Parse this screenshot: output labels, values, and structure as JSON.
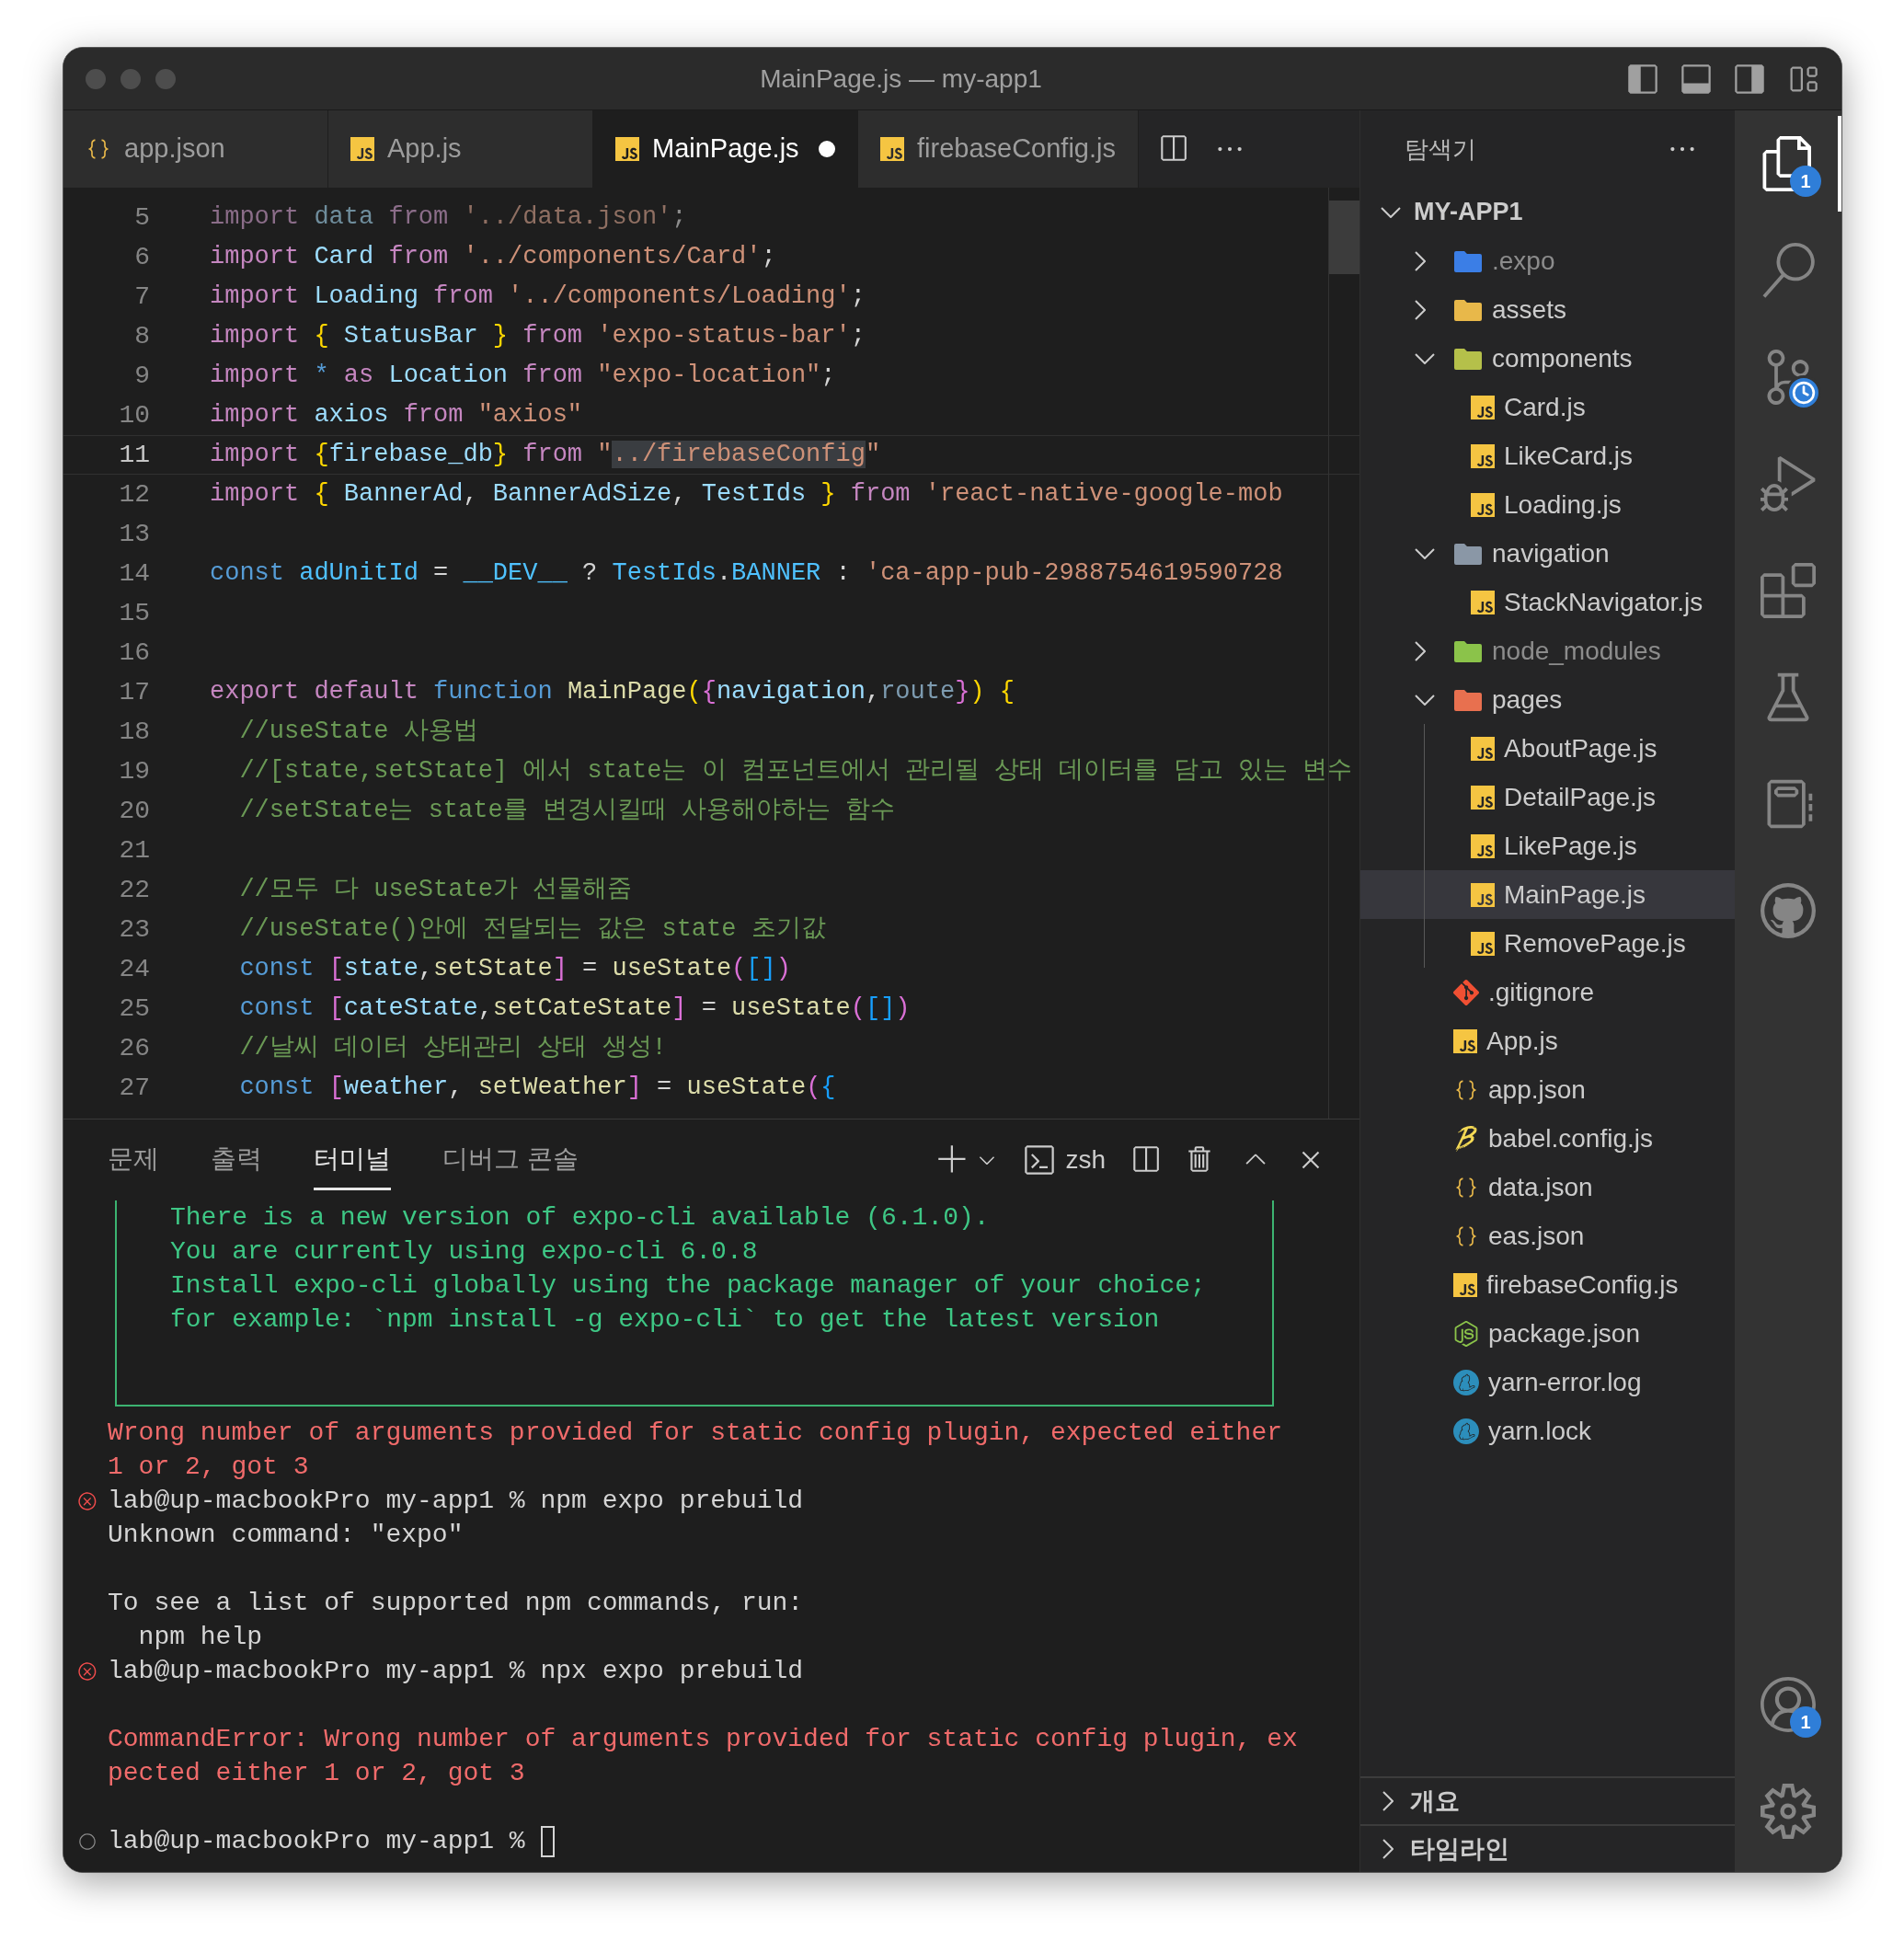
{
  "window": {
    "title": "MainPage.js — my-app1"
  },
  "tabs": [
    {
      "label": "app.json",
      "kind": "json",
      "selected": false,
      "modified": false
    },
    {
      "label": "App.js",
      "kind": "js",
      "selected": false,
      "modified": false
    },
    {
      "label": "MainPage.js",
      "kind": "js",
      "selected": true,
      "modified": true
    },
    {
      "label": "firebaseConfig.js",
      "kind": "js",
      "selected": false,
      "modified": false
    }
  ],
  "editor": {
    "lines": [
      {
        "n": "5",
        "current": false,
        "tokens": [
          {
            "kind": "kw_faded",
            "text": "import "
          },
          {
            "kind": "var_faded",
            "text": "data "
          },
          {
            "kind": "kw_faded",
            "text": "from "
          },
          {
            "kind": "str_faded",
            "text": "'../data.json'"
          },
          {
            "kind": "plain_faded",
            "text": ";"
          }
        ]
      },
      {
        "n": "6",
        "current": false,
        "tokens": [
          {
            "kind": "kw",
            "text": "import "
          },
          {
            "kind": "var",
            "text": "Card "
          },
          {
            "kind": "kw",
            "text": "from "
          },
          {
            "kind": "str",
            "text": "'../components/Card'"
          },
          {
            "kind": "plain",
            "text": ";"
          }
        ]
      },
      {
        "n": "7",
        "current": false,
        "tokens": [
          {
            "kind": "kw",
            "text": "import "
          },
          {
            "kind": "var",
            "text": "Loading "
          },
          {
            "kind": "kw",
            "text": "from "
          },
          {
            "kind": "str",
            "text": "'../components/Loading'"
          },
          {
            "kind": "plain",
            "text": ";"
          }
        ]
      },
      {
        "n": "8",
        "current": false,
        "tokens": [
          {
            "kind": "kw",
            "text": "import "
          },
          {
            "kind": "b1",
            "text": "{"
          },
          {
            "kind": "var",
            "text": " StatusBar "
          },
          {
            "kind": "b1",
            "text": "}"
          },
          {
            "kind": "kw",
            "text": " from "
          },
          {
            "kind": "str",
            "text": "'expo-status-bar'"
          },
          {
            "kind": "plain",
            "text": ";"
          }
        ]
      },
      {
        "n": "9",
        "current": false,
        "tokens": [
          {
            "kind": "kw",
            "text": "import "
          },
          {
            "kind": "storage",
            "text": "* "
          },
          {
            "kind": "kw",
            "text": "as "
          },
          {
            "kind": "var",
            "text": "Location "
          },
          {
            "kind": "kw",
            "text": "from "
          },
          {
            "kind": "str",
            "text": "\"expo-location\""
          },
          {
            "kind": "plain",
            "text": ";"
          }
        ]
      },
      {
        "n": "10",
        "current": false,
        "tokens": [
          {
            "kind": "kw",
            "text": "import "
          },
          {
            "kind": "var",
            "text": "axios "
          },
          {
            "kind": "kw",
            "text": "from "
          },
          {
            "kind": "str",
            "text": "\"axios\""
          }
        ]
      },
      {
        "n": "11",
        "current": true,
        "tokens": [
          {
            "kind": "kw",
            "text": "import "
          },
          {
            "kind": "b1",
            "text": "{"
          },
          {
            "kind": "var",
            "text": "firebase_db"
          },
          {
            "kind": "b1",
            "text": "}"
          },
          {
            "kind": "kw",
            "text": " from "
          },
          {
            "kind": "str",
            "text": "\""
          },
          {
            "kind": "str_hl",
            "text": "../firebaseConfig"
          },
          {
            "kind": "str",
            "text": "\""
          }
        ]
      },
      {
        "n": "12",
        "current": false,
        "tokens": [
          {
            "kind": "kw",
            "text": "import "
          },
          {
            "kind": "b1",
            "text": "{"
          },
          {
            "kind": "var",
            "text": " BannerAd"
          },
          {
            "kind": "plain",
            "text": ", "
          },
          {
            "kind": "var",
            "text": "BannerAdSize"
          },
          {
            "kind": "plain",
            "text": ", "
          },
          {
            "kind": "var",
            "text": "TestIds "
          },
          {
            "kind": "b1",
            "text": "}"
          },
          {
            "kind": "kw",
            "text": " from "
          },
          {
            "kind": "str",
            "text": "'react-native-google-mob"
          }
        ]
      },
      {
        "n": "13",
        "current": false
      },
      {
        "n": "14",
        "current": false,
        "tokens": [
          {
            "kind": "storage",
            "text": "const "
          },
          {
            "kind": "const",
            "text": "adUnitId"
          },
          {
            "kind": "plain",
            "text": " = "
          },
          {
            "kind": "const",
            "text": "__DEV__"
          },
          {
            "kind": "plain",
            "text": " ? "
          },
          {
            "kind": "const",
            "text": "TestIds"
          },
          {
            "kind": "plain",
            "text": "."
          },
          {
            "kind": "const",
            "text": "BANNER"
          },
          {
            "kind": "plain",
            "text": " : "
          },
          {
            "kind": "str",
            "text": "'ca-app-pub-2988754619590728"
          }
        ]
      },
      {
        "n": "15",
        "current": false
      },
      {
        "n": "16",
        "current": false
      },
      {
        "n": "17",
        "current": false,
        "tokens": [
          {
            "kind": "kw",
            "text": "export default "
          },
          {
            "kind": "storage",
            "text": "function "
          },
          {
            "kind": "func",
            "text": "MainPage"
          },
          {
            "kind": "b1",
            "text": "("
          },
          {
            "kind": "b2",
            "text": "{"
          },
          {
            "kind": "var",
            "text": "navigation"
          },
          {
            "kind": "plain",
            "text": ","
          },
          {
            "kind": "unused",
            "text": "route"
          },
          {
            "kind": "b2",
            "text": "}"
          },
          {
            "kind": "b1",
            "text": ")"
          },
          {
            "kind": "b1",
            "text": " {"
          }
        ]
      },
      {
        "n": "18",
        "current": false,
        "tokens": [
          {
            "kind": "comment",
            "text": "  //useState 사용법"
          }
        ]
      },
      {
        "n": "19",
        "current": false,
        "tokens": [
          {
            "kind": "comment",
            "text": "  //[state,setState] 에서 state는 이 컴포넌트에서 관리될 상태 데이터를 담고 있는 변수"
          }
        ]
      },
      {
        "n": "20",
        "current": false,
        "tokens": [
          {
            "kind": "comment",
            "text": "  //setState는 state를 변경시킬때 사용해야하는 함수"
          }
        ]
      },
      {
        "n": "21",
        "current": false
      },
      {
        "n": "22",
        "current": false,
        "tokens": [
          {
            "kind": "comment",
            "text": "  //모두 다 useState가 선물해줌"
          }
        ]
      },
      {
        "n": "23",
        "current": false,
        "tokens": [
          {
            "kind": "comment",
            "text": "  //useState()안에 전달되는 값은 state 초기값"
          }
        ]
      },
      {
        "n": "24",
        "current": false,
        "tokens": [
          {
            "kind": "storage",
            "text": "  const "
          },
          {
            "kind": "b2",
            "text": "["
          },
          {
            "kind": "var",
            "text": "state"
          },
          {
            "kind": "plain",
            "text": ","
          },
          {
            "kind": "func",
            "text": "setState"
          },
          {
            "kind": "b2",
            "text": "]"
          },
          {
            "kind": "plain",
            "text": " = "
          },
          {
            "kind": "func",
            "text": "useState"
          },
          {
            "kind": "b2",
            "text": "("
          },
          {
            "kind": "b3",
            "text": "[]"
          },
          {
            "kind": "b2",
            "text": ")"
          }
        ]
      },
      {
        "n": "25",
        "current": false,
        "tokens": [
          {
            "kind": "storage",
            "text": "  const "
          },
          {
            "kind": "b2",
            "text": "["
          },
          {
            "kind": "var",
            "text": "cateState"
          },
          {
            "kind": "plain",
            "text": ","
          },
          {
            "kind": "func",
            "text": "setCateState"
          },
          {
            "kind": "b2",
            "text": "]"
          },
          {
            "kind": "plain",
            "text": " = "
          },
          {
            "kind": "func",
            "text": "useState"
          },
          {
            "kind": "b2",
            "text": "("
          },
          {
            "kind": "b3",
            "text": "[]"
          },
          {
            "kind": "b2",
            "text": ")"
          }
        ]
      },
      {
        "n": "26",
        "current": false,
        "tokens": [
          {
            "kind": "comment",
            "text": "  //날씨 데이터 상태관리 상태 생성!"
          }
        ]
      },
      {
        "n": "27",
        "current": false,
        "tokens": [
          {
            "kind": "storage",
            "text": "  const "
          },
          {
            "kind": "b2",
            "text": "["
          },
          {
            "kind": "var",
            "text": "weather"
          },
          {
            "kind": "plain",
            "text": ", "
          },
          {
            "kind": "func",
            "text": "setWeather"
          },
          {
            "kind": "b2",
            "text": "]"
          },
          {
            "kind": "plain",
            "text": " = "
          },
          {
            "kind": "func",
            "text": "useState"
          },
          {
            "kind": "b2",
            "text": "("
          },
          {
            "kind": "b3",
            "text": "{"
          }
        ]
      }
    ]
  },
  "panel": {
    "tabs": [
      {
        "label": "문제",
        "selected": false
      },
      {
        "label": "출력",
        "selected": false
      },
      {
        "label": "터미널",
        "selected": true
      },
      {
        "label": "디버그 콘솔",
        "selected": false
      }
    ],
    "shell": "zsh",
    "terminal": {
      "box_lines": [
        "There is a new version of expo-cli available (6.1.0).",
        "You are currently using expo-cli 6.0.8",
        "Install expo-cli globally using the package manager of your choice;",
        "for example: `npm install -g expo-cli` to get the latest version"
      ],
      "lines": [
        {
          "kind": "error",
          "text": "Wrong number of arguments provided for static config plugin, expected either"
        },
        {
          "kind": "error",
          "text": "1 or 2, got 3"
        },
        {
          "kind": "prompt_failed",
          "text": "lab@up-macbookPro my-app1 % npm expo prebuild"
        },
        {
          "kind": "output",
          "text": "Unknown command: \"expo\""
        },
        {
          "kind": "blank"
        },
        {
          "kind": "output",
          "text": "To see a list of supported npm commands, run:"
        },
        {
          "kind": "output",
          "text": "  npm help"
        },
        {
          "kind": "prompt_failed",
          "text": "lab@up-macbookPro my-app1 % npx expo prebuild"
        },
        {
          "kind": "blank"
        },
        {
          "kind": "error",
          "text": "CommandError: Wrong number of arguments provided for static config plugin, ex"
        },
        {
          "kind": "error",
          "text": "pected either 1 or 2, got 3"
        },
        {
          "kind": "blank"
        },
        {
          "kind": "prompt_idle",
          "text": "lab@up-macbookPro my-app1 %"
        }
      ]
    }
  },
  "sidebar": {
    "title": "탐색기",
    "root": {
      "name": "MY-APP1",
      "expanded": true,
      "children": [
        {
          "name": ".expo",
          "kind": "expo-folder",
          "expanded": false,
          "selected": false,
          "dimmed": true
        },
        {
          "name": "assets",
          "kind": "assets-folder",
          "expanded": false,
          "selected": false,
          "dimmed": false
        },
        {
          "name": "components",
          "kind": "components-folder",
          "expanded": true,
          "selected": false,
          "dimmed": false,
          "children": [
            {
              "name": "Card.js",
              "kind": "js",
              "selected": false,
              "dimmed": false
            },
            {
              "name": "LikeCard.js",
              "kind": "js",
              "selected": false,
              "dimmed": false
            },
            {
              "name": "Loading.js",
              "kind": "js",
              "selected": false,
              "dimmed": false
            }
          ]
        },
        {
          "name": "navigation",
          "kind": "navigation-folder",
          "expanded": true,
          "selected": false,
          "dimmed": false,
          "children": [
            {
              "name": "StackNavigator.js",
              "kind": "js",
              "selected": false,
              "dimmed": false
            }
          ]
        },
        {
          "name": "node_modules",
          "kind": "node-folder",
          "expanded": false,
          "selected": false,
          "dimmed": true
        },
        {
          "name": "pages",
          "kind": "pages-folder",
          "expanded": true,
          "selected": false,
          "dimmed": false,
          "children": [
            {
              "name": "AboutPage.js",
              "kind": "js",
              "selected": false,
              "dimmed": false
            },
            {
              "name": "DetailPage.js",
              "kind": "js",
              "selected": false,
              "dimmed": false
            },
            {
              "name": "LikePage.js",
              "kind": "js",
              "selected": false,
              "dimmed": false
            },
            {
              "name": "MainPage.js",
              "kind": "js",
              "selected": true,
              "dimmed": false
            },
            {
              "name": "RemovePage.js",
              "kind": "js",
              "selected": false,
              "dimmed": false
            }
          ]
        },
        {
          "name": ".gitignore",
          "kind": "git",
          "selected": false,
          "dimmed": false
        },
        {
          "name": "App.js",
          "kind": "js",
          "selected": false,
          "dimmed": false
        },
        {
          "name": "app.json",
          "kind": "json",
          "selected": false,
          "dimmed": false
        },
        {
          "name": "babel.config.js",
          "kind": "babel",
          "selected": false,
          "dimmed": false
        },
        {
          "name": "data.json",
          "kind": "json",
          "selected": false,
          "dimmed": false
        },
        {
          "name": "eas.json",
          "kind": "json",
          "selected": false,
          "dimmed": false
        },
        {
          "name": "firebaseConfig.js",
          "kind": "js",
          "selected": false,
          "dimmed": false
        },
        {
          "name": "package.json",
          "kind": "node",
          "selected": false,
          "dimmed": false
        },
        {
          "name": "yarn-error.log",
          "kind": "yarn",
          "selected": false,
          "dimmed": false
        },
        {
          "name": "yarn.lock",
          "kind": "yarn",
          "selected": false,
          "dimmed": false
        }
      ]
    },
    "sections": [
      {
        "title": "개요",
        "expanded": false
      },
      {
        "title": "타임라인",
        "expanded": false
      }
    ]
  },
  "activity_bar": {
    "top": [
      {
        "kind": "explorer",
        "selected": true,
        "badge": "1"
      },
      {
        "kind": "search",
        "selected": false
      },
      {
        "kind": "source-control",
        "selected": false
      },
      {
        "kind": "run-debug",
        "selected": false
      },
      {
        "kind": "extensions",
        "selected": false
      },
      {
        "kind": "testing",
        "selected": false
      },
      {
        "kind": "notebook",
        "selected": false
      },
      {
        "kind": "github",
        "selected": false
      }
    ],
    "bottom": [
      {
        "kind": "account",
        "selected": false,
        "badge": "1"
      },
      {
        "kind": "settings",
        "selected": false
      }
    ]
  }
}
